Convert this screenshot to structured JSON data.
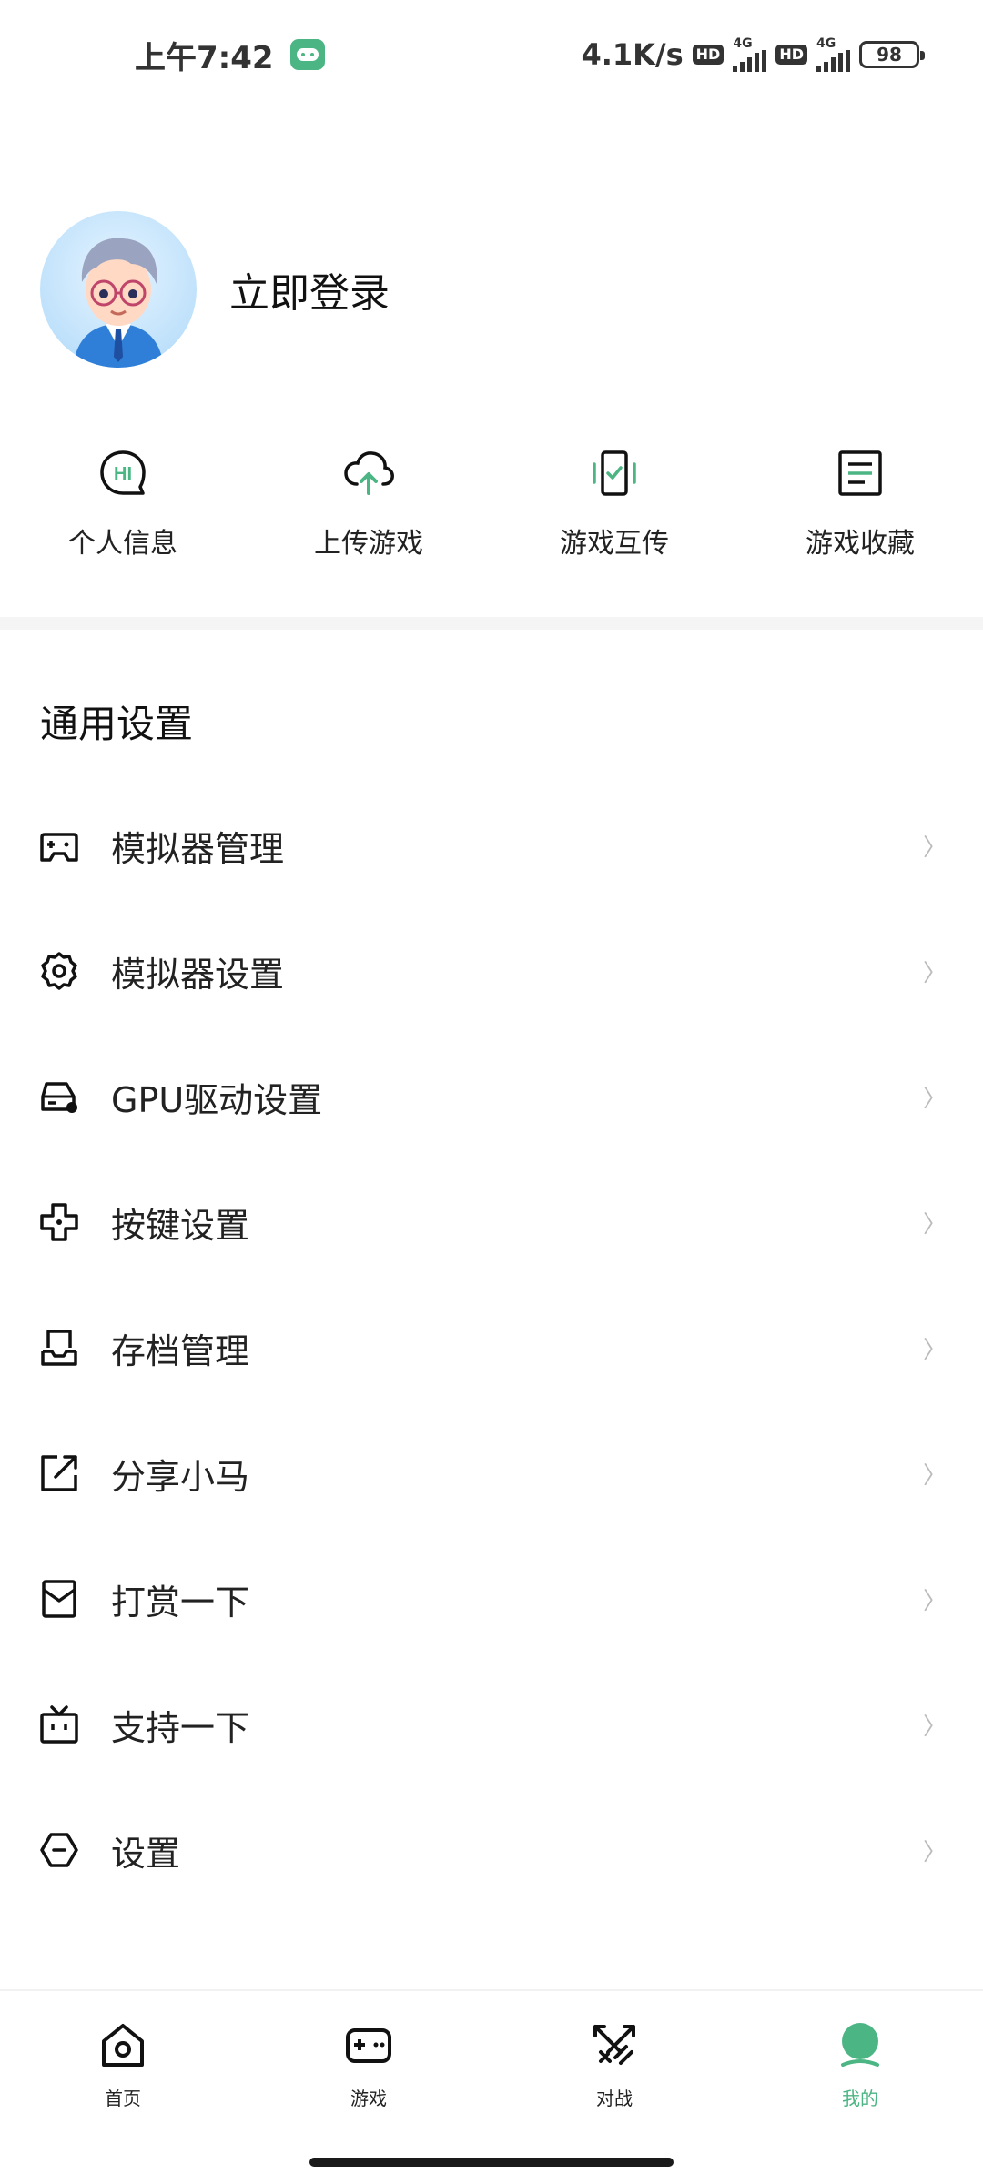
{
  "status_bar": {
    "time": "上午7:42",
    "speed": "4.1K/s",
    "hd": "HD",
    "network": "4G",
    "battery": "98"
  },
  "profile": {
    "login_label": "立即登录"
  },
  "quick_actions": [
    {
      "label": "个人信息",
      "icon": "hi-bubble-icon"
    },
    {
      "label": "上传游戏",
      "icon": "cloud-upload-icon"
    },
    {
      "label": "游戏互传",
      "icon": "phone-transfer-icon"
    },
    {
      "label": "游戏收藏",
      "icon": "document-favorites-icon"
    }
  ],
  "settings": {
    "title": "通用设置",
    "items": [
      {
        "label": "模拟器管理",
        "icon": "gamepad-icon"
      },
      {
        "label": "模拟器设置",
        "icon": "gear-icon"
      },
      {
        "label": "GPU驱动设置",
        "icon": "gpu-icon"
      },
      {
        "label": "按键设置",
        "icon": "dpad-icon"
      },
      {
        "label": "存档管理",
        "icon": "save-tray-icon"
      },
      {
        "label": "分享小马",
        "icon": "share-external-icon"
      },
      {
        "label": "打赏一下",
        "icon": "reward-envelope-icon"
      },
      {
        "label": "支持一下",
        "icon": "tv-icon"
      },
      {
        "label": "设置",
        "icon": "hexagon-settings-icon"
      }
    ],
    "chevron": "〉"
  },
  "bottom_nav": {
    "items": [
      {
        "label": "首页",
        "icon": "home-icon",
        "active": false
      },
      {
        "label": "游戏",
        "icon": "game-controller-icon",
        "active": false
      },
      {
        "label": "对战",
        "icon": "battle-swords-icon",
        "active": false
      },
      {
        "label": "我的",
        "icon": "profile-icon",
        "active": true
      }
    ]
  },
  "colors": {
    "accent": "#4cb584",
    "text": "#222222",
    "divider": "#f5f5f5"
  }
}
